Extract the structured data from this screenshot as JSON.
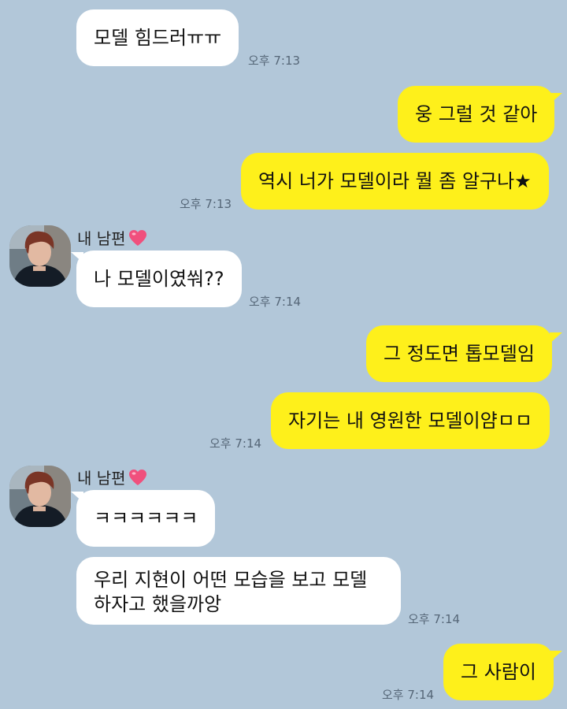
{
  "colors": {
    "background": "#b2c7d9",
    "incoming_bubble": "#ffffff",
    "outgoing_bubble": "#fef01b"
  },
  "contact": {
    "name": "내 남편",
    "name_icon": "heart-icon",
    "avatar_icon": "profile-photo"
  },
  "messages": [
    {
      "side": "in",
      "text": "모델 힘드러ㅠㅠ",
      "time": "오후 7:13"
    },
    {
      "side": "out",
      "text": "웅 그럴 것 같아",
      "time": ""
    },
    {
      "side": "out",
      "text": "역시 너가 모델이라 뭘 좀 알구나★",
      "time": "오후 7:13"
    },
    {
      "side": "in",
      "text": "나 모델이였쒀??",
      "time": "오후 7:14"
    },
    {
      "side": "out",
      "text": "그 정도면 톱모델임",
      "time": ""
    },
    {
      "side": "out",
      "text": "자기는 내 영원한 모델이얌ㅁㅁ",
      "time": "오후 7:14"
    },
    {
      "side": "in",
      "text": "ㅋㅋㅋㅋㅋㅋ",
      "time": ""
    },
    {
      "side": "in",
      "text": "우리 지현이 어떤 모습을 보고 모델 하자고 했을까앙",
      "time": "오후 7:14"
    },
    {
      "side": "out",
      "text": "그 사람이",
      "time": "오후 7:14"
    }
  ]
}
